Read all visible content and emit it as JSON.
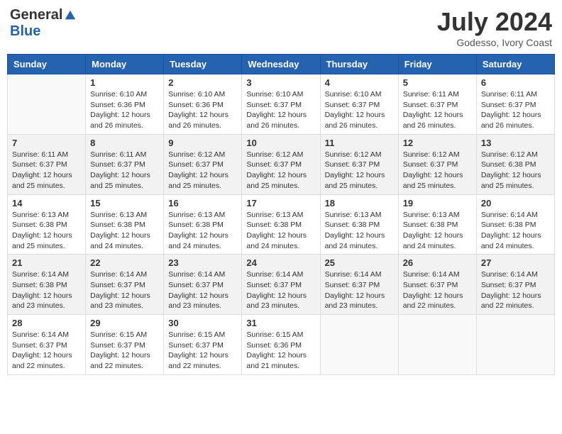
{
  "header": {
    "logo_general": "General",
    "logo_blue": "Blue",
    "month_year": "July 2024",
    "location": "Godesso, Ivory Coast"
  },
  "days_of_week": [
    "Sunday",
    "Monday",
    "Tuesday",
    "Wednesday",
    "Thursday",
    "Friday",
    "Saturday"
  ],
  "weeks": [
    {
      "shade": false,
      "days": [
        {
          "date": "",
          "info": ""
        },
        {
          "date": "1",
          "info": "Sunrise: 6:10 AM\nSunset: 6:36 PM\nDaylight: 12 hours\nand 26 minutes."
        },
        {
          "date": "2",
          "info": "Sunrise: 6:10 AM\nSunset: 6:36 PM\nDaylight: 12 hours\nand 26 minutes."
        },
        {
          "date": "3",
          "info": "Sunrise: 6:10 AM\nSunset: 6:37 PM\nDaylight: 12 hours\nand 26 minutes."
        },
        {
          "date": "4",
          "info": "Sunrise: 6:10 AM\nSunset: 6:37 PM\nDaylight: 12 hours\nand 26 minutes."
        },
        {
          "date": "5",
          "info": "Sunrise: 6:11 AM\nSunset: 6:37 PM\nDaylight: 12 hours\nand 26 minutes."
        },
        {
          "date": "6",
          "info": "Sunrise: 6:11 AM\nSunset: 6:37 PM\nDaylight: 12 hours\nand 26 minutes."
        }
      ]
    },
    {
      "shade": true,
      "days": [
        {
          "date": "7",
          "info": ""
        },
        {
          "date": "8",
          "info": "Sunrise: 6:11 AM\nSunset: 6:37 PM\nDaylight: 12 hours\nand 25 minutes."
        },
        {
          "date": "9",
          "info": "Sunrise: 6:12 AM\nSunset: 6:37 PM\nDaylight: 12 hours\nand 25 minutes."
        },
        {
          "date": "10",
          "info": "Sunrise: 6:12 AM\nSunset: 6:37 PM\nDaylight: 12 hours\nand 25 minutes."
        },
        {
          "date": "11",
          "info": "Sunrise: 6:12 AM\nSunset: 6:37 PM\nDaylight: 12 hours\nand 25 minutes."
        },
        {
          "date": "12",
          "info": "Sunrise: 6:12 AM\nSunset: 6:37 PM\nDaylight: 12 hours\nand 25 minutes."
        },
        {
          "date": "13",
          "info": "Sunrise: 6:12 AM\nSunset: 6:38 PM\nDaylight: 12 hours\nand 25 minutes."
        }
      ]
    },
    {
      "shade": false,
      "days": [
        {
          "date": "14",
          "info": ""
        },
        {
          "date": "15",
          "info": "Sunrise: 6:13 AM\nSunset: 6:38 PM\nDaylight: 12 hours\nand 24 minutes."
        },
        {
          "date": "16",
          "info": "Sunrise: 6:13 AM\nSunset: 6:38 PM\nDaylight: 12 hours\nand 24 minutes."
        },
        {
          "date": "17",
          "info": "Sunrise: 6:13 AM\nSunset: 6:38 PM\nDaylight: 12 hours\nand 24 minutes."
        },
        {
          "date": "18",
          "info": "Sunrise: 6:13 AM\nSunset: 6:38 PM\nDaylight: 12 hours\nand 24 minutes."
        },
        {
          "date": "19",
          "info": "Sunrise: 6:13 AM\nSunset: 6:38 PM\nDaylight: 12 hours\nand 24 minutes."
        },
        {
          "date": "20",
          "info": "Sunrise: 6:14 AM\nSunset: 6:38 PM\nDaylight: 12 hours\nand 24 minutes."
        }
      ]
    },
    {
      "shade": true,
      "days": [
        {
          "date": "21",
          "info": ""
        },
        {
          "date": "22",
          "info": "Sunrise: 6:14 AM\nSunset: 6:37 PM\nDaylight: 12 hours\nand 23 minutes."
        },
        {
          "date": "23",
          "info": "Sunrise: 6:14 AM\nSunset: 6:37 PM\nDaylight: 12 hours\nand 23 minutes."
        },
        {
          "date": "24",
          "info": "Sunrise: 6:14 AM\nSunset: 6:37 PM\nDaylight: 12 hours\nand 23 minutes."
        },
        {
          "date": "25",
          "info": "Sunrise: 6:14 AM\nSunset: 6:37 PM\nDaylight: 12 hours\nand 23 minutes."
        },
        {
          "date": "26",
          "info": "Sunrise: 6:14 AM\nSunset: 6:37 PM\nDaylight: 12 hours\nand 22 minutes."
        },
        {
          "date": "27",
          "info": "Sunrise: 6:14 AM\nSunset: 6:37 PM\nDaylight: 12 hours\nand 22 minutes."
        }
      ]
    },
    {
      "shade": false,
      "days": [
        {
          "date": "28",
          "info": "Sunrise: 6:14 AM\nSunset: 6:37 PM\nDaylight: 12 hours\nand 22 minutes."
        },
        {
          "date": "29",
          "info": "Sunrise: 6:15 AM\nSunset: 6:37 PM\nDaylight: 12 hours\nand 22 minutes."
        },
        {
          "date": "30",
          "info": "Sunrise: 6:15 AM\nSunset: 6:37 PM\nDaylight: 12 hours\nand 22 minutes."
        },
        {
          "date": "31",
          "info": "Sunrise: 6:15 AM\nSunset: 6:36 PM\nDaylight: 12 hours\nand 21 minutes."
        },
        {
          "date": "",
          "info": ""
        },
        {
          "date": "",
          "info": ""
        },
        {
          "date": "",
          "info": ""
        }
      ]
    }
  ],
  "week1_day7_info": "Sunrise: 6:11 AM\nSunset: 6:37 PM\nDaylight: 12 hours\nand 25 minutes.",
  "week3_day14_info": "Sunrise: 6:13 AM\nSunset: 6:38 PM\nDaylight: 12 hours\nand 25 minutes.",
  "week4_day21_info": "Sunrise: 6:14 AM\nSunset: 6:38 PM\nDaylight: 12 hours\nand 23 minutes."
}
